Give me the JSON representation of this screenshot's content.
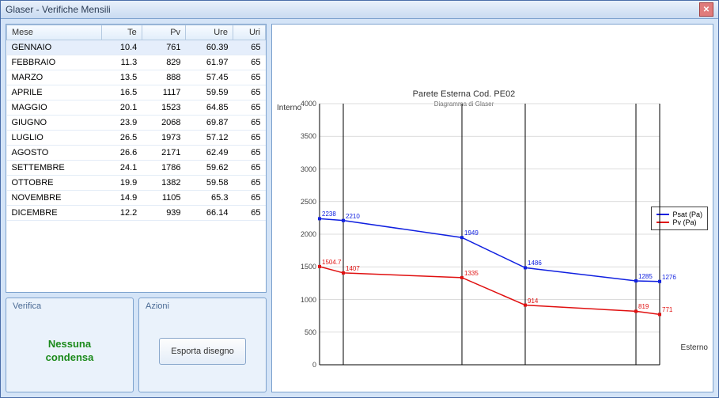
{
  "window": {
    "title": "Glaser - Verifiche Mensili"
  },
  "table": {
    "headers": {
      "mese": "Mese",
      "te": "Te",
      "pv": "Pv",
      "ure": "Ure",
      "uri": "Uri"
    },
    "rows": [
      {
        "mese": "GENNAIO",
        "te": "10.4",
        "pv": "761",
        "ure": "60.39",
        "uri": "65",
        "selected": true
      },
      {
        "mese": "FEBBRAIO",
        "te": "11.3",
        "pv": "829",
        "ure": "61.97",
        "uri": "65"
      },
      {
        "mese": "MARZO",
        "te": "13.5",
        "pv": "888",
        "ure": "57.45",
        "uri": "65"
      },
      {
        "mese": "APRILE",
        "te": "16.5",
        "pv": "1117",
        "ure": "59.59",
        "uri": "65"
      },
      {
        "mese": "MAGGIO",
        "te": "20.1",
        "pv": "1523",
        "ure": "64.85",
        "uri": "65"
      },
      {
        "mese": "GIUGNO",
        "te": "23.9",
        "pv": "2068",
        "ure": "69.87",
        "uri": "65"
      },
      {
        "mese": "LUGLIO",
        "te": "26.5",
        "pv": "1973",
        "ure": "57.12",
        "uri": "65"
      },
      {
        "mese": "AGOSTO",
        "te": "26.6",
        "pv": "2171",
        "ure": "62.49",
        "uri": "65"
      },
      {
        "mese": "SETTEMBRE",
        "te": "24.1",
        "pv": "1786",
        "ure": "59.62",
        "uri": "65"
      },
      {
        "mese": "OTTOBRE",
        "te": "19.9",
        "pv": "1382",
        "ure": "59.58",
        "uri": "65"
      },
      {
        "mese": "NOVEMBRE",
        "te": "14.9",
        "pv": "1105",
        "ure": "65.3",
        "uri": "65"
      },
      {
        "mese": "DICEMBRE",
        "te": "12.2",
        "pv": "939",
        "ure": "66.14",
        "uri": "65"
      }
    ]
  },
  "panels": {
    "verifica_title": "Verifica",
    "verifica_result_line1": "Nessuna",
    "verifica_result_line2": "condensa",
    "azioni_title": "Azioni",
    "esporta_label": "Esporta disegno"
  },
  "chart": {
    "title": "Parete Esterna Cod. PE02",
    "subtitle": "Diagramma di Glaser",
    "interno": "Interno",
    "esterno": "Esterno",
    "legend": {
      "psat": "Psat (Pa)",
      "pv": "Pv (Pa)"
    },
    "colors": {
      "psat": "#1020e0",
      "pv": "#e01010"
    },
    "y_ticks": [
      "4000",
      "3500",
      "3000",
      "2500",
      "2000",
      "1500",
      "1000",
      "500",
      "0"
    ]
  },
  "chart_data": {
    "type": "line",
    "ylim": [
      0,
      4000
    ],
    "ylabel": "Pa",
    "title": "Parete Esterna Cod. PE02",
    "x_positions": [
      0,
      30,
      180,
      260,
      400,
      430
    ],
    "series": [
      {
        "name": "Psat (Pa)",
        "color": "#1020e0",
        "values": [
          2238,
          2210,
          1949,
          1486,
          1285,
          1276
        ]
      },
      {
        "name": "Pv (Pa)",
        "color": "#e01010",
        "values": [
          1504.7,
          1407,
          1335,
          914,
          819,
          771
        ]
      }
    ],
    "layer_boundaries_x": [
      0,
      30,
      180,
      260,
      400,
      430
    ]
  }
}
